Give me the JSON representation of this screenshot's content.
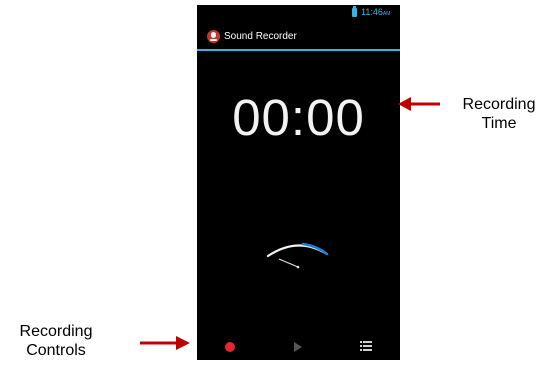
{
  "status_bar": {
    "time": "11:46",
    "ampm": "AM",
    "battery_icon": "battery-icon"
  },
  "action_bar": {
    "app_icon": "microphone-icon",
    "title": "Sound Recorder",
    "accent_color": "#33b5e5"
  },
  "recorder": {
    "timer": "00:00",
    "level_meter_icon": "level-meter-icon"
  },
  "controls": {
    "record_icon": "record-icon",
    "record_color": "#e8242e",
    "play_icon": "play-icon",
    "list_icon": "list-icon"
  },
  "annotations": {
    "recording_time": "Recording\nTime",
    "recording_controls": "Recording\nControls",
    "arrow_color": "#c00000"
  }
}
